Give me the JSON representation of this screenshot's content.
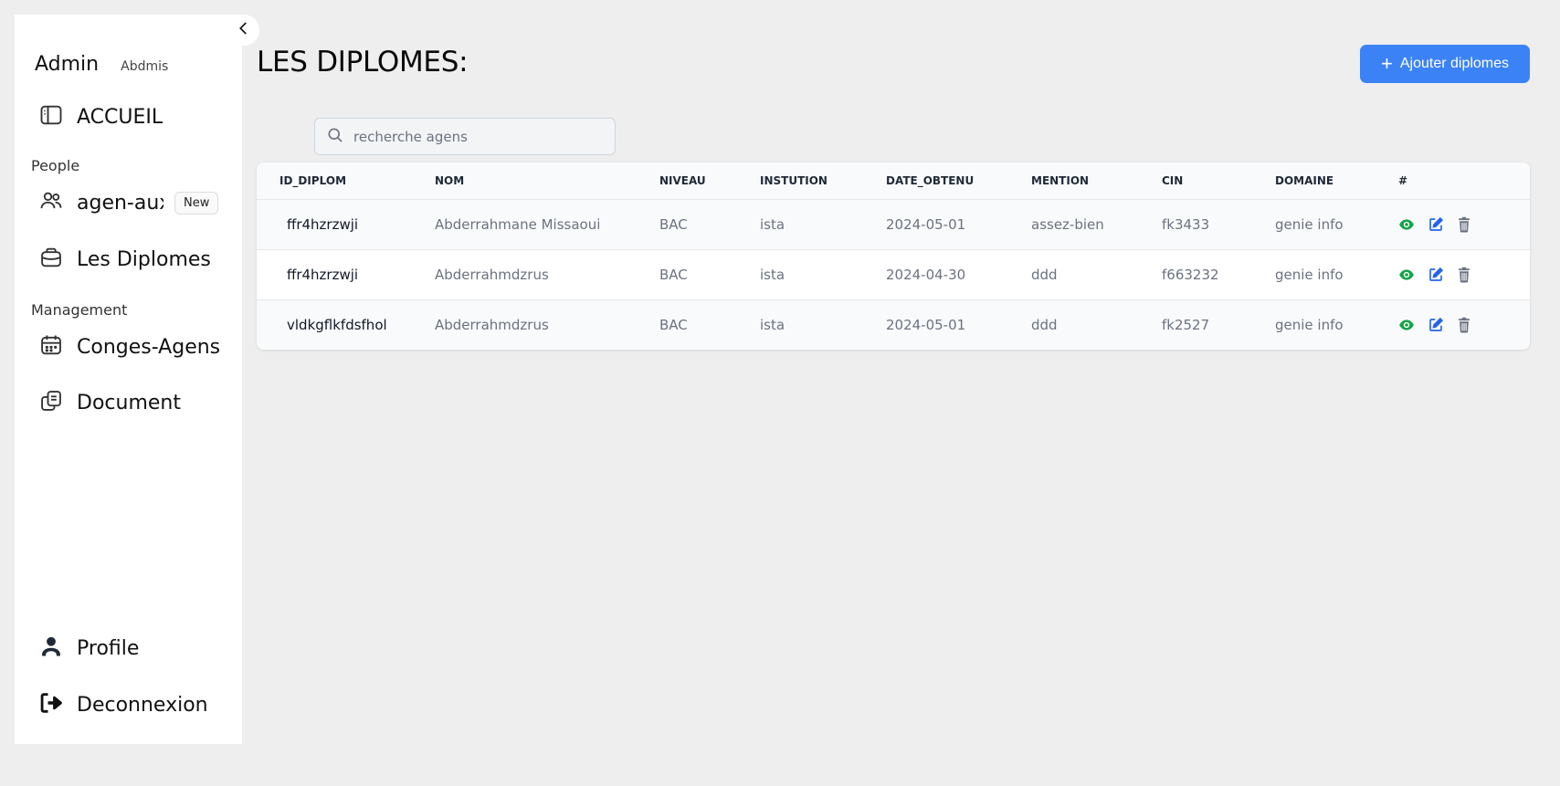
{
  "sidebar": {
    "brand_title": "Admin",
    "brand_sub": "Abdmis",
    "items": [
      {
        "label": "ACCUEIL",
        "icon": "sidebar-panel-icon"
      },
      {
        "label": "agen-aux",
        "icon": "users-icon",
        "badge": "New"
      },
      {
        "label": "Les Diplomes",
        "icon": "bag-icon"
      },
      {
        "label": "Conges-Agens",
        "icon": "calendar-icon"
      },
      {
        "label": "Document",
        "icon": "documents-icon"
      },
      {
        "label": "Profile",
        "icon": "user-icon"
      },
      {
        "label": "Deconnexion",
        "icon": "logout-icon"
      }
    ],
    "sections": {
      "people": "People",
      "management": "Management"
    }
  },
  "main": {
    "title": "LES DIPLOMES:",
    "add_button": "Ajouter diplomes",
    "search": {
      "placeholder": "recherche agens",
      "value": ""
    }
  },
  "table": {
    "columns": [
      "ID_DIPLOM",
      "NOM",
      "NIVEAU",
      "INSTUTION",
      "DATE_OBTENU",
      "MENTION",
      "CIN",
      "DOMAINE",
      "#"
    ],
    "rows": [
      [
        "ffr4hzrzwji",
        "Abderrahmane Missaoui",
        "BAC",
        "ista",
        "2024-05-01",
        "assez-bien",
        "fk3433",
        "genie info"
      ],
      [
        "ffr4hzrzwji",
        "Abderrahmdzrus",
        "BAC",
        "ista",
        "2024-04-30",
        "ddd",
        "f663232",
        "genie info"
      ],
      [
        "vldkgflkfdsfhol",
        "Abderrahmdzrus",
        "BAC",
        "ista",
        "2024-05-01",
        "ddd",
        "fk2527",
        "genie info"
      ]
    ]
  },
  "colors": {
    "accent": "#3b82f6",
    "view_icon": "#16a34a",
    "edit_icon": "#2563eb",
    "delete_icon": "#6b7280",
    "background": "#eeeeee"
  }
}
